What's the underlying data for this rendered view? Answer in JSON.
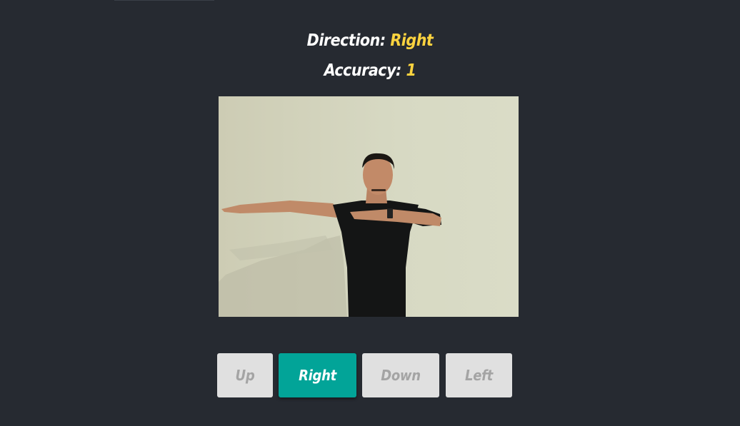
{
  "status": {
    "direction_label": "Direction:",
    "direction_value": "Right",
    "accuracy_label": "Accuracy:",
    "accuracy_value": "1"
  },
  "camera": {
    "description": "webcam-feed"
  },
  "buttons": [
    {
      "label": "Up",
      "active": false
    },
    {
      "label": "Right",
      "active": true
    },
    {
      "label": "Down",
      "active": false
    },
    {
      "label": "Left",
      "active": false
    }
  ],
  "colors": {
    "background": "#262a31",
    "accent_text": "#fcd33f",
    "active_button": "#02a498",
    "inactive_button": "#e0e0e0"
  }
}
